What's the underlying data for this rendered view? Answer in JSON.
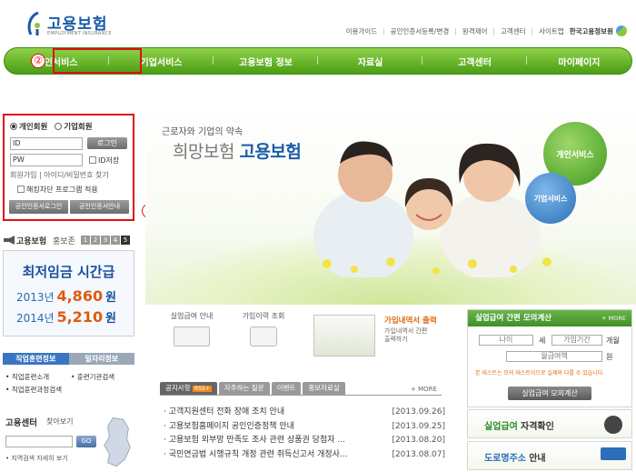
{
  "header": {
    "logo_title": "고용보험",
    "logo_sub": "EMPLOYMENT INSURANCE",
    "links": [
      "이용가이드",
      "공인인증서등록/변경",
      "원격제어",
      "고객센터",
      "사이트맵"
    ],
    "brand": "한국고용정보원"
  },
  "nav": {
    "items": [
      "개인서비스",
      "기업서비스",
      "고용보험 정보",
      "자료실",
      "고객센터",
      "마이페이지"
    ]
  },
  "annotations": {
    "one": "①",
    "two": "②"
  },
  "login": {
    "member_personal": "개인회원",
    "member_company": "기업회원",
    "id_value": "ID",
    "pw_value": "PW",
    "login_btn": "로그인",
    "save_id": "ID저장",
    "join": "회원가입",
    "find": "아이디/비밀번호 찾기",
    "hack": "해킹차단 프로그램 적용",
    "cert_login": "공인인증서로그인",
    "cert_info": "공인인증서안내"
  },
  "hero": {
    "tagline": "근로자와 기업의 약속",
    "title_a": "희망보험",
    "title_b": "고용보험",
    "btn_personal": "개인서비스",
    "btn_company": "기업서비스"
  },
  "promo": {
    "label": "고용보험",
    "label2": "홍보존",
    "pages": [
      "1",
      "2",
      "3",
      "4",
      "5"
    ],
    "headline": "최저임금 시간급",
    "y2013": "2013년",
    "v2013": "4,860",
    "won1": "원",
    "y2014": "2014년",
    "v2014": "5,210",
    "won2": "원"
  },
  "training": {
    "tab1": "직업훈련정보",
    "tab2": "일자리정보",
    "links": [
      "직업훈련소개",
      "훈련기관검색",
      "직업훈련과정검색"
    ]
  },
  "center": {
    "title": "고용센터",
    "find": "찾아보기",
    "go": "GO",
    "detail": "지역검색 자세히 보기"
  },
  "services": {
    "s1": "실업급여 안내",
    "s2": "가입이력 조회",
    "s3": "가입내역서 출력",
    "s3_desc": "가입내역서 간편 출력하기"
  },
  "notices": {
    "tabs": [
      "공지사항",
      "RSS+",
      "자주하는 질문",
      "이벤트",
      "홍보자료실"
    ],
    "more": "+ MORE",
    "rows": [
      {
        "t": "고객지원센터 전화 장애 조치 안내",
        "d": "[2013.09.26]"
      },
      {
        "t": "고용보험홈페이지 공인인증정책 안내",
        "d": "[2013.09.25]"
      },
      {
        "t": "고용보험 외부망 만족도 조사 관련 상품권 당첨자 ...",
        "d": "[2013.08.20]"
      },
      {
        "t": "국민연금법 시행규칙 개정 관련 취득신고서 개정사...",
        "d": "[2013.08.07]"
      }
    ]
  },
  "calc": {
    "title": "실업급여 간편 모의계산",
    "more": "+ MORE",
    "age": "나이",
    "age_unit": "세",
    "period": "가입기간",
    "period_unit": "개월",
    "wage": "월급여액",
    "wage_unit": "원",
    "note": "본 테스트는 모의 테스트이므로 실제와 다를 수 있습니다.",
    "btn": "실업급여 모의계산"
  },
  "qual": {
    "a": "실업급여",
    "b": "자격확인"
  },
  "road": {
    "a": "도로명주소",
    "b": "안내"
  }
}
